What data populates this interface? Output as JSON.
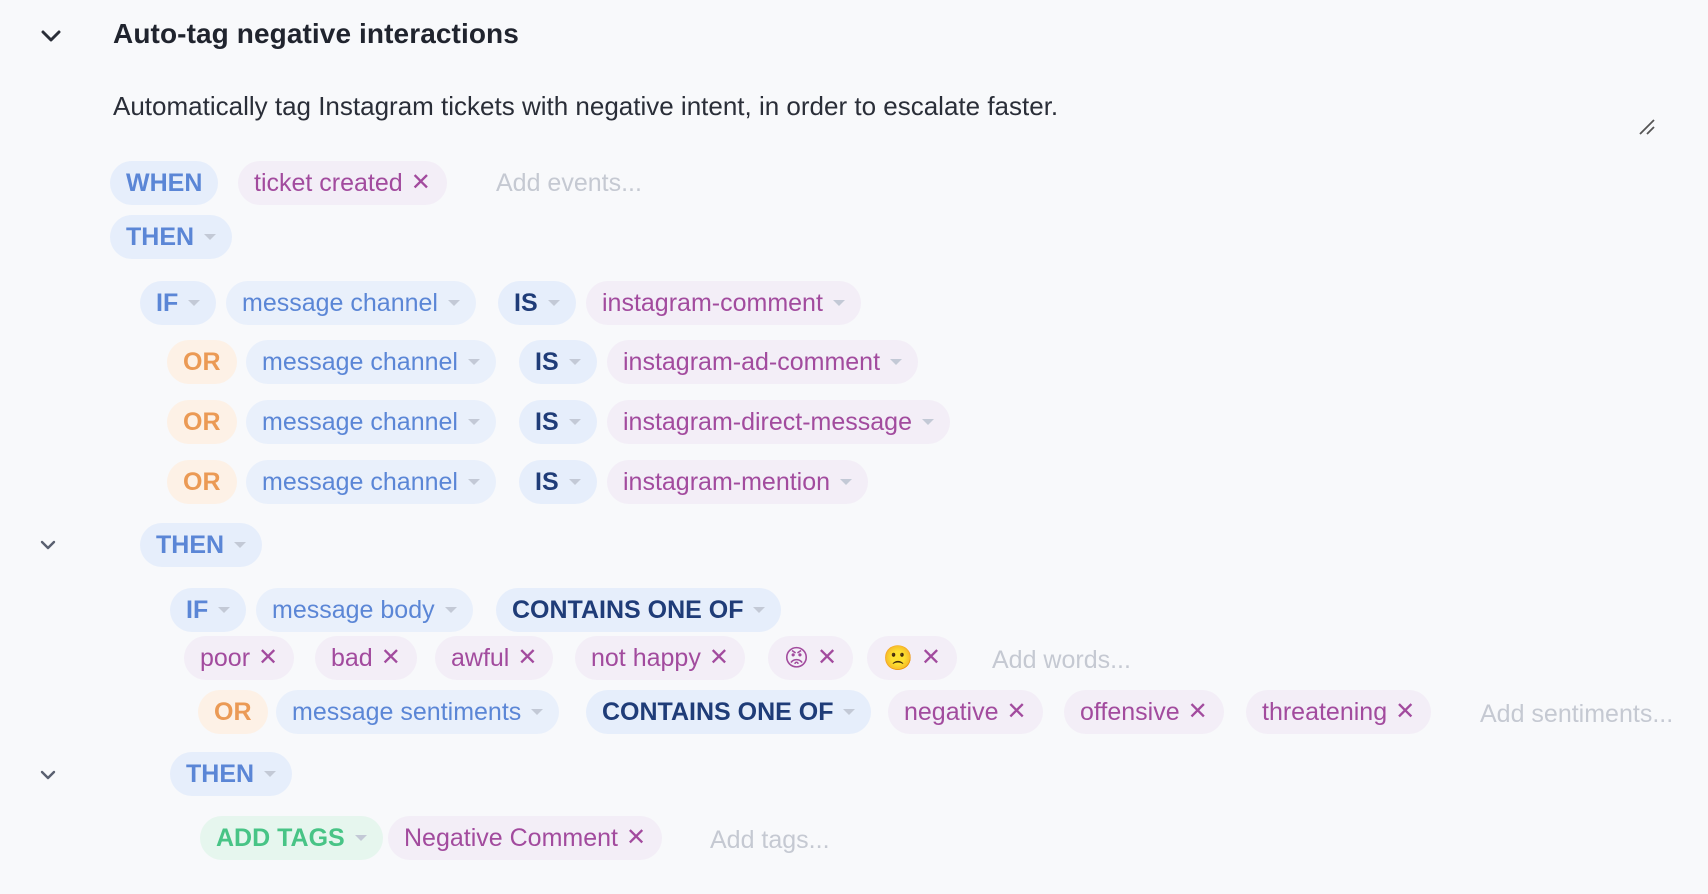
{
  "rule": {
    "title": "Auto-tag negative interactions",
    "description": "Automatically tag Instagram tickets with negative intent, in order to escalate faster."
  },
  "trigger": {
    "when_label": "WHEN",
    "event": "ticket created",
    "add_events_placeholder": "Add events..."
  },
  "then1": {
    "label": "THEN"
  },
  "if1": {
    "label": "IF",
    "field": "message channel",
    "operator": "IS",
    "value": "instagram-comment",
    "or_conditions": [
      {
        "label": "OR",
        "field": "message channel",
        "operator": "IS",
        "value": "instagram-ad-comment"
      },
      {
        "label": "OR",
        "field": "message channel",
        "operator": "IS",
        "value": "instagram-direct-message"
      },
      {
        "label": "OR",
        "field": "message channel",
        "operator": "IS",
        "value": "instagram-mention"
      }
    ]
  },
  "then2": {
    "label": "THEN"
  },
  "if2": {
    "label": "IF",
    "field": "message body",
    "operator": "CONTAINS ONE OF",
    "words": [
      "poor",
      "bad",
      "awful",
      "not happy",
      "😡",
      "🙁"
    ],
    "add_words_placeholder": "Add words...",
    "or": {
      "label": "OR",
      "field": "message sentiments",
      "operator": "CONTAINS ONE OF",
      "sentiments": [
        "negative",
        "offensive",
        "threatening"
      ],
      "add_sentiments_placeholder": "Add sentiments..."
    }
  },
  "then3": {
    "label": "THEN"
  },
  "action": {
    "label": "ADD TAGS",
    "tag": "Negative Comment",
    "add_tags_placeholder": "Add tags..."
  },
  "colors": {
    "keyword_blue": "#5b86d6",
    "keyword_orange": "#eb9a55",
    "keyword_green": "#48c486",
    "value_purple": "#a24b9e",
    "operator_navy": "#1f3c78"
  }
}
